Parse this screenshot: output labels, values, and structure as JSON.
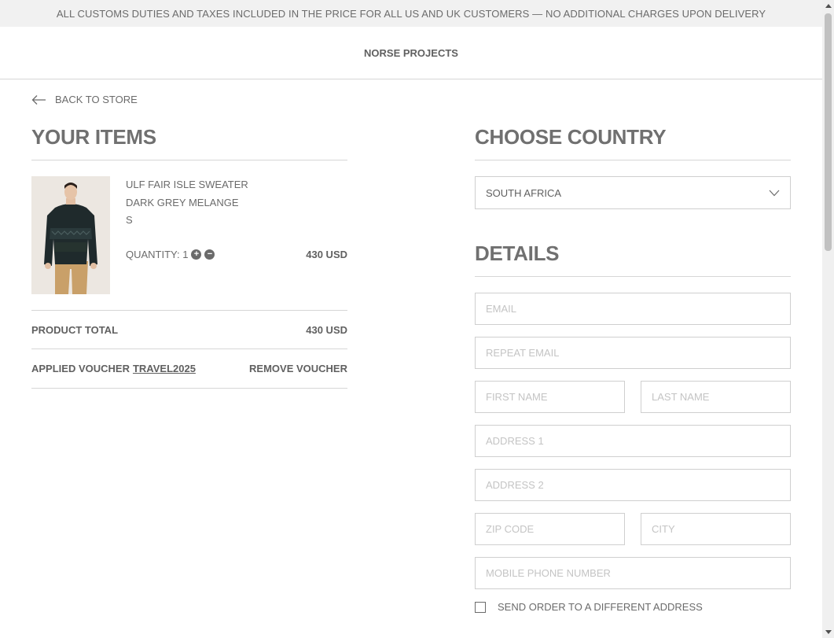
{
  "banner": {
    "text": "ALL CUSTOMS DUTIES AND TAXES INCLUDED IN THE PRICE FOR ALL US AND UK CUSTOMERS — NO ADDITIONAL CHARGES UPON DELIVERY"
  },
  "header": {
    "brand": "NORSE PROJECTS"
  },
  "nav": {
    "back_label": "BACK TO STORE",
    "back_icon": "arrow-left-icon"
  },
  "items_section": {
    "title": "YOUR ITEMS",
    "items": [
      {
        "name": "ULF FAIR ISLE SWEATER",
        "color": "DARK GREY MELANGE",
        "size": "S",
        "quantity_label": "QUANTITY: 1",
        "quantity": 1,
        "plus_symbol": "+",
        "minus_symbol": "−",
        "price": "430 USD"
      }
    ],
    "product_total_label": "PRODUCT TOTAL",
    "product_total_value": "430 USD",
    "voucher_label": "APPLIED VOUCHER",
    "voucher_code": "TRAVEL2025",
    "remove_voucher_label": "REMOVE VOUCHER"
  },
  "country_section": {
    "title": "CHOOSE COUNTRY",
    "selected_country": "SOUTH AFRICA",
    "chevron_icon": "chevron-down-icon"
  },
  "details_section": {
    "title": "DETAILS",
    "fields": {
      "email": "EMAIL",
      "repeat_email": "REPEAT EMAIL",
      "first_name": "FIRST NAME",
      "last_name": "LAST NAME",
      "address1": "ADDRESS 1",
      "address2": "ADDRESS 2",
      "zip": "ZIP CODE",
      "city": "CITY",
      "phone": "MOBILE PHONE NUMBER"
    },
    "different_address_label": "SEND ORDER TO A DIFFERENT ADDRESS"
  },
  "colors": {
    "text": "#6b6b6b",
    "banner_bg": "#f1f1f1",
    "border": "#cfcfcf",
    "placeholder": "#c4c4c4"
  }
}
